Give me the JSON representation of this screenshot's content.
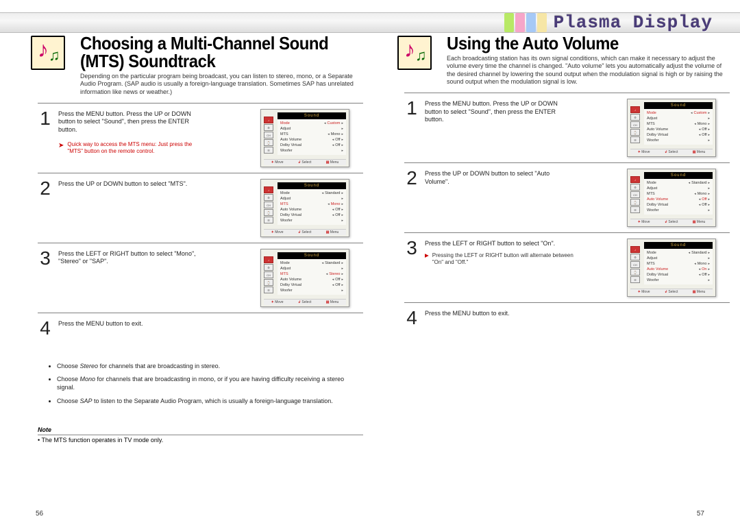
{
  "header": {
    "brand": "Plasma Display"
  },
  "left": {
    "title": "Choosing a Multi-Channel Sound (MTS) Soundtrack",
    "intro": "Depending on the particular program being broadcast, you can listen to stereo, mono, or a Separate Audio Program. (SAP audio is usually a foreign-language translation. Sometimes SAP has unrelated information like news or weather.)",
    "quick": "Quick way to access the MTS menu: Just press the \"MTS\" button on the remote control.",
    "steps": [
      "Press the MENU button. Press the UP or DOWN button to select \"Sound\", then press the ENTER button.",
      "Press the UP or DOWN button to select \"MTS\".",
      "Press the LEFT or RIGHT button to select \"Mono\", \"Stereo\" or \"SAP\".",
      "Press the MENU button to exit."
    ],
    "choices": [
      {
        "pre": "Choose ",
        "b": "Stereo",
        "post": " for channels that are broadcasting in stereo."
      },
      {
        "pre": "Choose ",
        "b": "Mono",
        "post": " for channels that are broadcasting in mono, or if you are having difficulty receiving a stereo signal."
      },
      {
        "pre": "Choose ",
        "b": "SAP",
        "post": " to listen to the Separate Audio Program, which is usually a foreign-language translation."
      }
    ],
    "note_label": "Note",
    "note": "• The MTS function operates in TV mode only.",
    "pagenum": "56",
    "osd": {
      "header": "Sound",
      "rows_labels": [
        "Mode",
        "Adjust",
        "MTS",
        "Auto Volume",
        "Dolby Virtual",
        "Woofer"
      ],
      "foot": [
        "Move",
        "Select",
        "Menu"
      ],
      "screens": [
        {
          "hi": 0,
          "vals": [
            "Custom",
            "",
            "Mono",
            "Off",
            "Off",
            ""
          ]
        },
        {
          "hi": 2,
          "vals": [
            "Standard",
            "",
            "Mono",
            "Off",
            "Off",
            ""
          ]
        },
        {
          "hi": 2,
          "vals": [
            "Standard",
            "",
            "Stereo",
            "Off",
            "Off",
            ""
          ]
        }
      ]
    }
  },
  "right": {
    "title": "Using the Auto Volume",
    "intro": "Each broadcasting station has its own signal conditions, which can make it necessary to adjust the volume every time the channel is changed. \"Auto volume\" lets you automatically adjust the volume of the desired channel by lowering the sound output when the modulation signal is high or by raising the sound output when the modulation signal is low.",
    "steps": [
      "Press the MENU button. Press the UP or DOWN button to select \"Sound\", then press the ENTER button.",
      "Press the UP or DOWN button to select \"Auto Volume\".",
      "Press the LEFT or RIGHT button to select \"On\"."
    ],
    "step3_bullet": "Pressing the LEFT or RIGHT button will alternate between \"On\" and \"Off.\"",
    "step4": "Press the MENU button to exit.",
    "pagenum": "57",
    "osd": {
      "header": "Sound",
      "rows_labels": [
        "Mode",
        "Adjust",
        "MTS",
        "Auto Volume",
        "Dolby Virtual",
        "Woofer"
      ],
      "foot": [
        "Move",
        "Select",
        "Menu"
      ],
      "screens": [
        {
          "hi": 0,
          "vals": [
            "Custom",
            "",
            "Mono",
            "Off",
            "Off",
            ""
          ]
        },
        {
          "hi": 3,
          "vals": [
            "Standard",
            "",
            "Mono",
            "Off",
            "Off",
            ""
          ]
        },
        {
          "hi": 3,
          "vals": [
            "Standard",
            "",
            "Mono",
            "On",
            "Off",
            ""
          ]
        }
      ]
    }
  }
}
